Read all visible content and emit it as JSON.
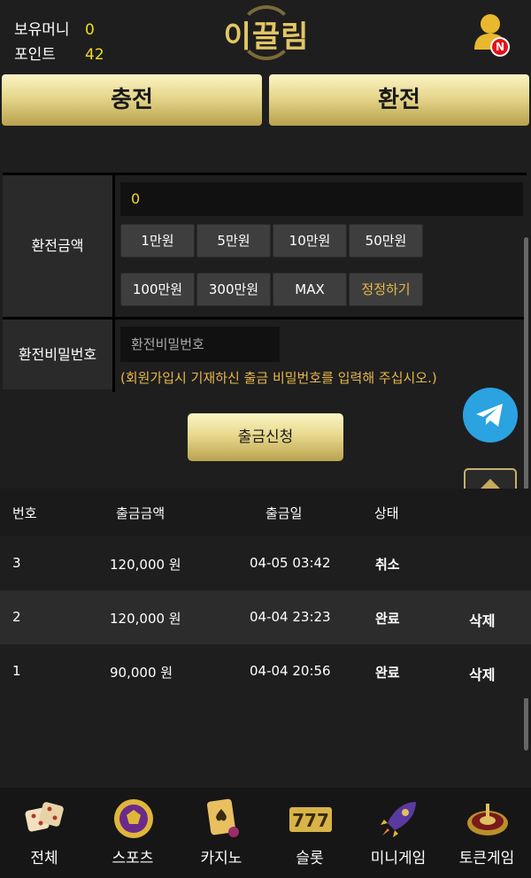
{
  "header": {
    "money_label": "보유머니",
    "money_value": "0",
    "point_label": "포인트",
    "point_value": "42",
    "logo_text": "이끌림",
    "user_badge": "N"
  },
  "tabs": {
    "charge": "충전",
    "exchange": "환전"
  },
  "form": {
    "amount_label": "환전금액",
    "amount_value": "0",
    "amount_buttons": [
      "1만원",
      "5만원",
      "10만원",
      "50만원",
      "100만원",
      "300만원",
      "MAX",
      "정정하기"
    ],
    "password_label": "환전비밀번호",
    "password_placeholder": "환전비밀번호",
    "password_hint": "(회원가입시 기재하신 출금 비밀번호를 입력해 주십시오.)"
  },
  "submit_label": "출금신청",
  "table": {
    "headers": [
      "번호",
      "출금금액",
      "출금일",
      "상태"
    ],
    "rows": [
      {
        "no": "3",
        "amount": "120,000 원",
        "date": "04-05 03:42",
        "status": "취소",
        "action": ""
      },
      {
        "no": "2",
        "amount": "120,000 원",
        "date": "04-04 23:23",
        "status": "완료",
        "action": "삭제"
      },
      {
        "no": "1",
        "amount": "90,000 원",
        "date": "04-04 20:56",
        "status": "완료",
        "action": "삭제"
      }
    ]
  },
  "bottom_nav": {
    "items": [
      {
        "label": "전체",
        "icon": "dice-icon"
      },
      {
        "label": "스포츠",
        "icon": "soccer-ball-icon"
      },
      {
        "label": "카지노",
        "icon": "playing-cards-icon"
      },
      {
        "label": "슬롯",
        "icon": "slot-777-icon"
      },
      {
        "label": "미니게임",
        "icon": "rocket-icon"
      },
      {
        "label": "토큰게임",
        "icon": "roulette-icon"
      }
    ]
  },
  "colors": {
    "gold": "#e3c664",
    "yellow_value": "#f0dc1e",
    "hint": "#e8b84a",
    "telegram": "#2aa3e0",
    "badge_red": "#e2121a"
  }
}
